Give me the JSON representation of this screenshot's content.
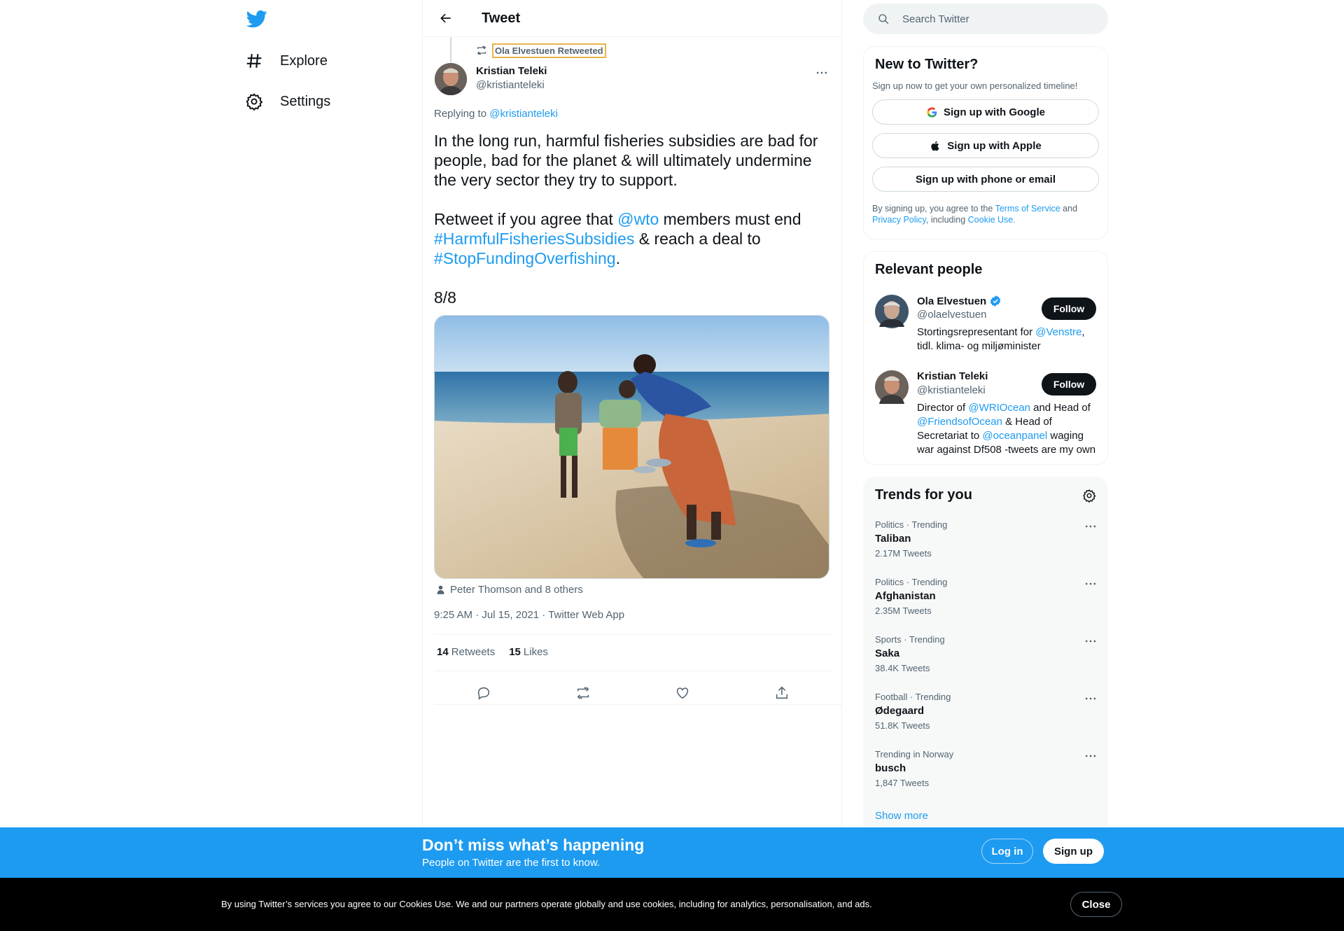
{
  "nav": {
    "items": [
      {
        "label": "Explore",
        "icon": "hashtag-icon"
      },
      {
        "label": "Settings",
        "icon": "gear-icon"
      }
    ]
  },
  "header": {
    "title": "Tweet"
  },
  "tweet": {
    "retweeted_by": "Ola Elvestuen Retweeted",
    "author_name": "Kristian Teleki",
    "author_handle": "@kristianteleki",
    "replying_prefix": "Replying to",
    "replying_handle": "@kristianteleki",
    "text_p1": "In the long run, harmful fisheries subsidies are bad for people, bad for the planet & will ultimately undermine the very sector they try to support.",
    "text_p2_a": "Retweet if you agree that ",
    "text_p2_mention": "@wto",
    "text_p2_b": " members must end ",
    "text_p2_tag1": "#HarmfulFisheriesSubsidies",
    "text_p2_c": " & reach a deal to ",
    "text_p2_tag2": "#StopFundingOverfishing",
    "text_p2_d": ".",
    "text_p3": "8/8",
    "tagged": "Peter Thomson and 8 others",
    "meta": "9:25 AM · Jul 15, 2021 · Twitter Web App",
    "retweets_count": "14",
    "retweets_label": "Retweets",
    "likes_count": "15",
    "likes_label": "Likes"
  },
  "search": {
    "placeholder": "Search Twitter"
  },
  "new_to_twitter": {
    "title": "New to Twitter?",
    "subtitle": "Sign up now to get your own personalized timeline!",
    "google": "Sign up with Google",
    "apple": "Sign up with Apple",
    "phone": "Sign up with phone or email",
    "terms_a": "By signing up, you agree to the ",
    "terms_link1": "Terms of Service",
    "terms_b": " and ",
    "terms_link2": "Privacy Policy",
    "terms_c": ", including ",
    "terms_link3": "Cookie Use."
  },
  "relevant": {
    "title": "Relevant people",
    "people": [
      {
        "name": "Ola Elvestuen",
        "handle": "@olaelvestuen",
        "verified": true,
        "bio_a": "Stortingsrepresentant for ",
        "bio_link1": "@Venstre",
        "bio_b": ", tidl. klima- og miljøminister",
        "follow": "Follow"
      },
      {
        "name": "Kristian Teleki",
        "handle": "@kristianteleki",
        "verified": false,
        "bio_a": "Director of ",
        "bio_link1": "@WRIOcean",
        "bio_b": " and Head of ",
        "bio_link2": "@FriendsofOcean",
        "bio_c": " & Head of Secretariat to ",
        "bio_link3": "@oceanpanel",
        "bio_d": " waging war against Df508 -tweets are my own",
        "follow": "Follow"
      }
    ]
  },
  "trends": {
    "title": "Trends for you",
    "items": [
      {
        "category": "Politics · Trending",
        "name": "Taliban",
        "count": "2.17M Tweets"
      },
      {
        "category": "Politics · Trending",
        "name": "Afghanistan",
        "count": "2.35M Tweets"
      },
      {
        "category": "Sports · Trending",
        "name": "Saka",
        "count": "38.4K Tweets"
      },
      {
        "category": "Football · Trending",
        "name": "Ødegaard",
        "count": "51.8K Tweets"
      },
      {
        "category": "Trending in Norway",
        "name": "busch",
        "count": "1,847 Tweets"
      }
    ],
    "show_more": "Show more"
  },
  "banner": {
    "headline": "Don’t miss what’s happening",
    "subline": "People on Twitter are the first to know.",
    "login": "Log in",
    "signup": "Sign up"
  },
  "cookies": {
    "text": "By using Twitter’s services you agree to our Cookies Use. We and our partners operate globally and use cookies, including for analytics, personalisation, and ads.",
    "close": "Close"
  },
  "colors": {
    "accent": "#1d9bf0",
    "text": "#0f1419",
    "muted": "#536471",
    "verified": "#1d9bf0"
  }
}
